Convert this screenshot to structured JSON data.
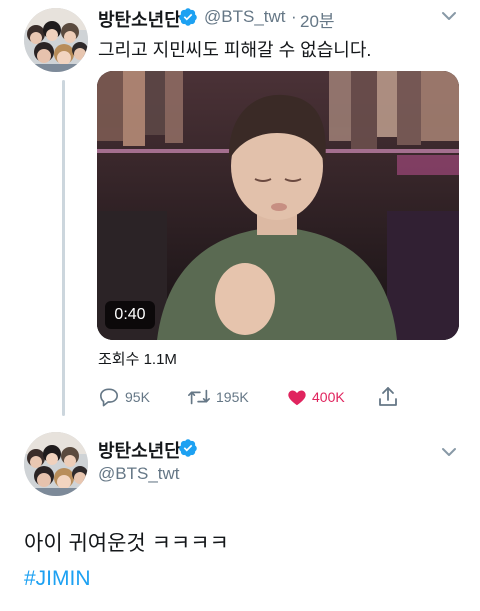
{
  "tweet1": {
    "display_name": "방탄소년단",
    "handle": "@BTS_twt",
    "separator": "·",
    "time": "20분",
    "text": "그리고 지민씨도 피해갈 수 없습니다.",
    "media": {
      "duration": "0:40"
    },
    "views_text": "조회수 1.1M",
    "actions": {
      "replies": "95K",
      "retweets": "195K",
      "likes": "400K"
    }
  },
  "tweet2": {
    "display_name": "방탄소년단",
    "handle": "@BTS_twt",
    "text": "아이 귀여운것 ㅋㅋㅋㅋ",
    "hashtag": "#JIMIN"
  },
  "colors": {
    "verified": "#1da1f2",
    "like_active": "#e0245e",
    "hashtag": "#1da1f2",
    "muted": "#657786"
  },
  "icons": [
    "verified-badge-icon",
    "chevron-down-icon",
    "reply-icon",
    "retweet-icon",
    "heart-icon",
    "share-icon"
  ]
}
